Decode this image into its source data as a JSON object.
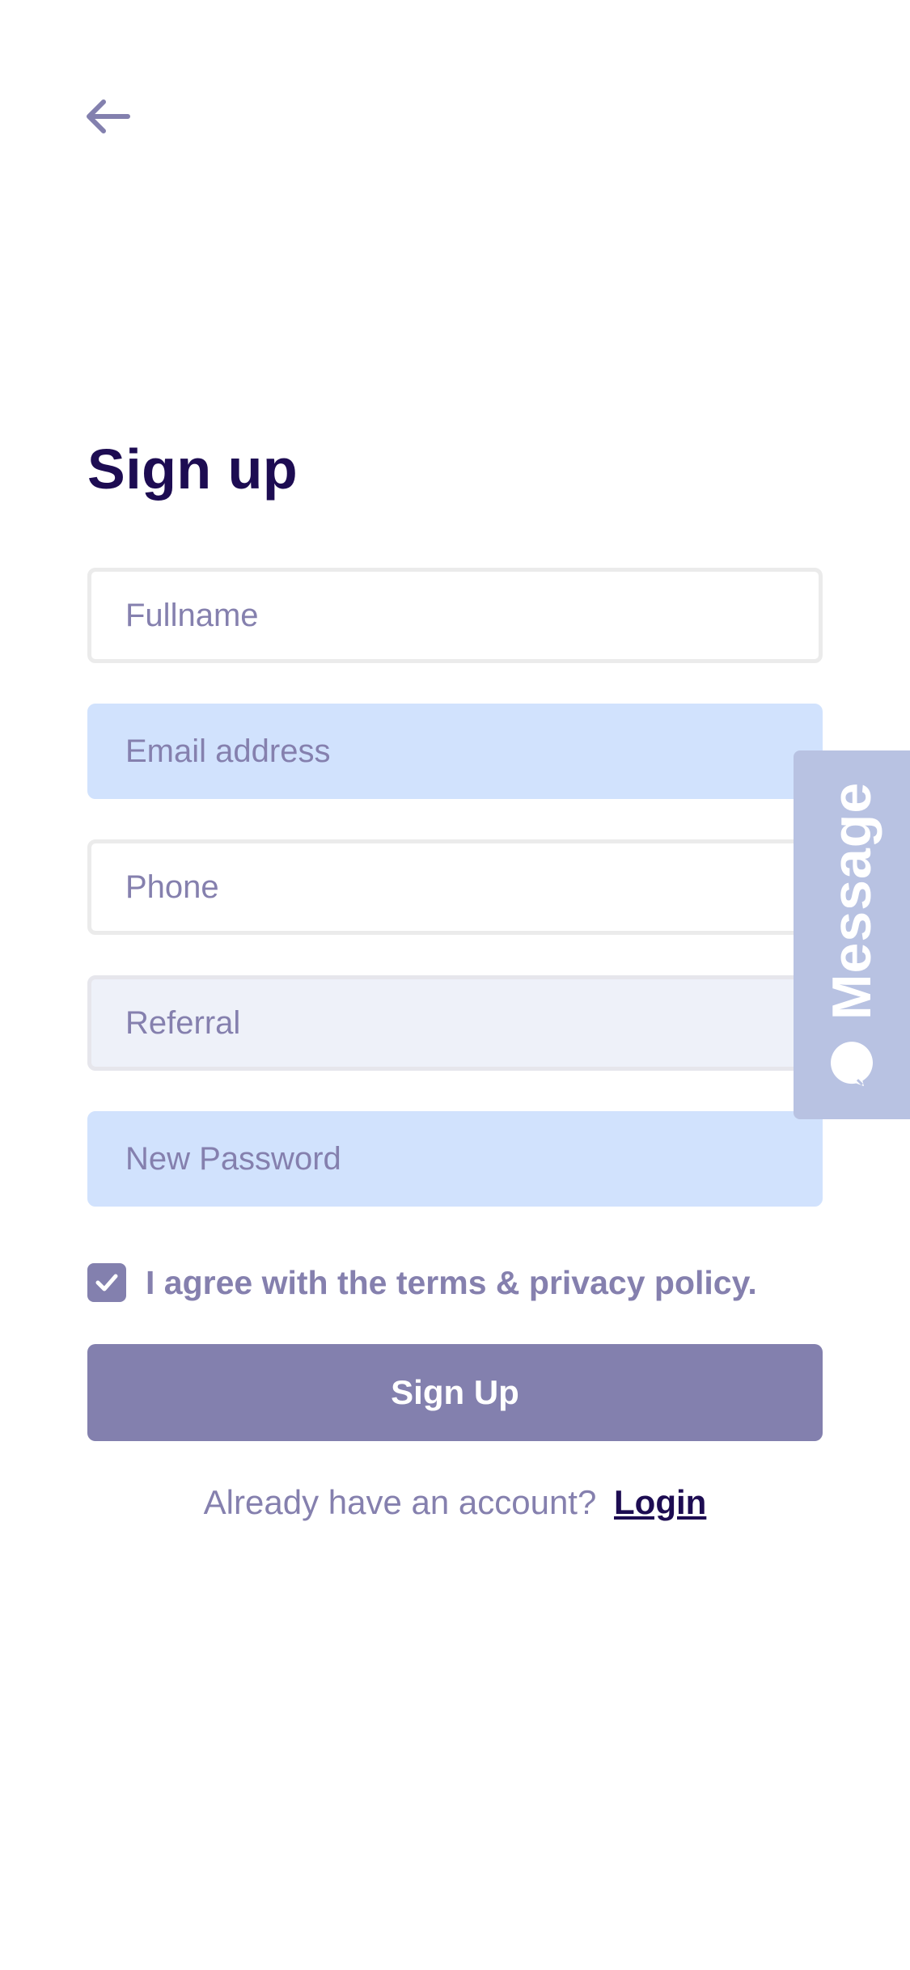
{
  "header": {
    "back_icon": "arrow-left-icon"
  },
  "form": {
    "title": "Sign up",
    "fields": {
      "fullname": {
        "placeholder": "Fullname",
        "value": ""
      },
      "email": {
        "placeholder": "Email address",
        "value": ""
      },
      "phone": {
        "placeholder": "Phone",
        "value": ""
      },
      "referral": {
        "placeholder": "Referral",
        "value": ""
      },
      "password": {
        "placeholder": "New Password",
        "value": ""
      }
    },
    "agree": {
      "checked": true,
      "label": "I agree with the terms & privacy policy."
    },
    "submit_label": "Sign Up",
    "login_prompt": "Already have an account?",
    "login_link": "Login"
  },
  "message_tab": {
    "label": "Message",
    "icon": "chat-bubble-icon"
  },
  "colors": {
    "primary_dark": "#1d0c52",
    "accent": "#8380ae",
    "placeholder": "#8580ae",
    "field_blue": "#d1e2fd",
    "field_gray": "#eef1f9",
    "message_tab": "#b8c2e2"
  }
}
